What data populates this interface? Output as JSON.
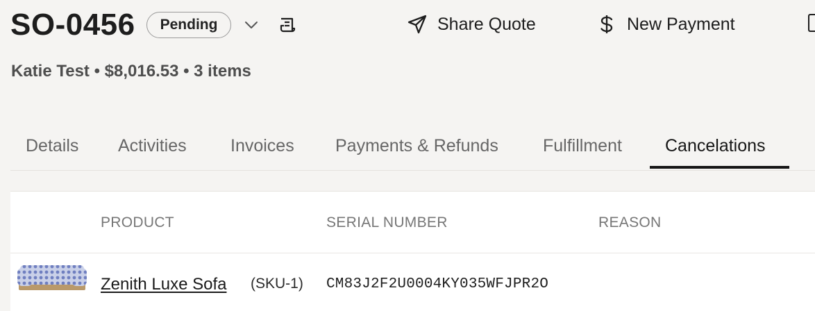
{
  "header": {
    "order_number": "SO-0456",
    "status": "Pending",
    "share_label": "Share Quote",
    "payment_label": "New Payment"
  },
  "subtitle": "Katie Test • $8,016.53 • 3 items",
  "tabs": [
    {
      "label": "Details",
      "active": false
    },
    {
      "label": "Activities",
      "active": false
    },
    {
      "label": "Invoices",
      "active": false
    },
    {
      "label": "Payments & Refunds",
      "active": false
    },
    {
      "label": "Fulfillment",
      "active": false
    },
    {
      "label": "Cancelations",
      "active": true
    }
  ],
  "table": {
    "columns": [
      "PRODUCT",
      "SERIAL NUMBER",
      "REASON"
    ],
    "rows": [
      {
        "product": "Zenith Luxe Sofa",
        "sku": "(SKU-1)",
        "serial": "CM83J2F2U0004KY035WFJPR2O",
        "reason": ""
      }
    ]
  },
  "icons": {
    "status_dropdown": "chevron-down-icon",
    "receipt": "receipt-icon",
    "share": "send-icon",
    "payment": "dollar-icon",
    "product_image": "sofa-thumbnail"
  },
  "colors": {
    "background": "#f5f4f2",
    "active_tab": "#161616",
    "inactive_tab": "#666666",
    "table_bg": "#ffffff"
  }
}
